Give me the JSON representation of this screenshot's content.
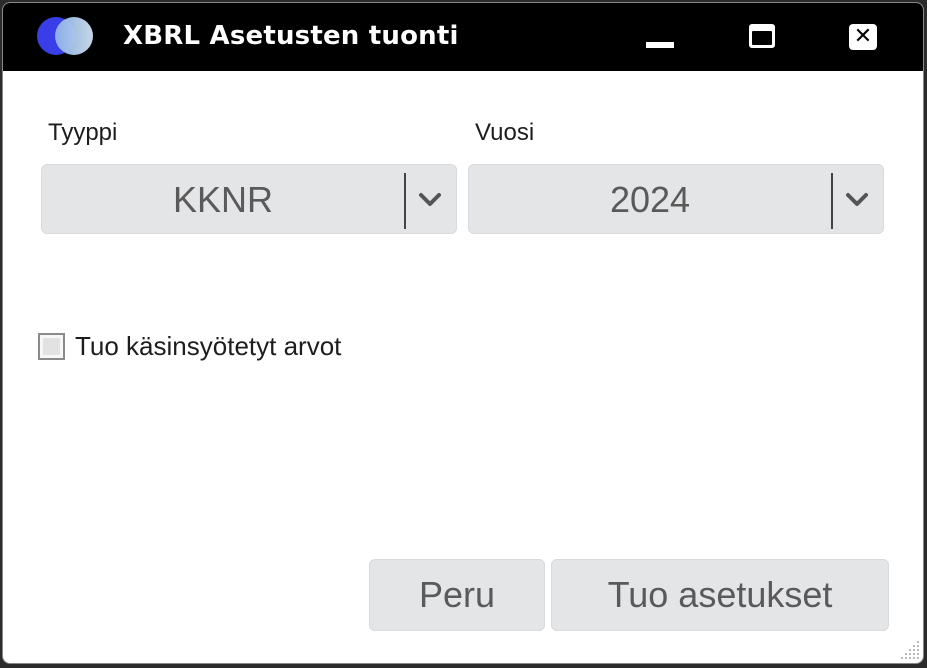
{
  "window": {
    "title": "XBRL Asetusten tuonti",
    "icon": "app-logo",
    "controls": [
      "minimize-icon",
      "maximize-icon",
      "close-icon"
    ],
    "close_glyph": "✕"
  },
  "form": {
    "type_label": "Tyyppi",
    "type_value": "KKNR",
    "year_label": "Vuosi",
    "year_value": "2024",
    "checkbox_label": "Tuo käsinsyötetyt arvot",
    "checkbox_checked": false
  },
  "buttons": {
    "cancel_label": "Peru",
    "import_label": "Tuo asetukset"
  },
  "colors": {
    "titlebar": "#000000",
    "control_bg": "#e4e5e7",
    "control_text": "#5a5a5a"
  }
}
